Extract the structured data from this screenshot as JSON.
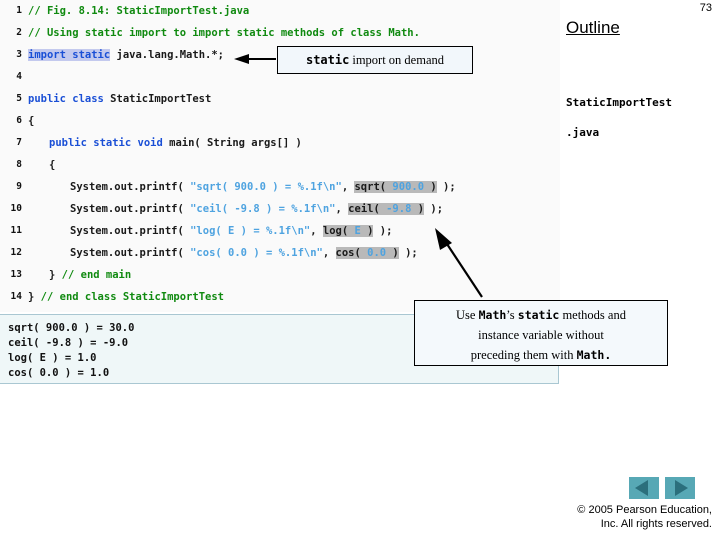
{
  "page": {
    "number": "73",
    "background_color": "#ffffff"
  },
  "outline": {
    "title": "Outline",
    "file_lines": [
      "StaticImportTest",
      ".java"
    ]
  },
  "code_panel": {
    "background_color": "#fafafa",
    "comment_color": "#108a10",
    "keyword_color": "#1a4fd6",
    "string_color": "#4ea3e0",
    "highlight_import_color": "#c3c9ee",
    "highlight_call_color": "#b9b9b9",
    "lines": [
      {
        "num": "1",
        "indent": 0,
        "tokens": [
          {
            "t": "// Fig. 8.14: StaticImportTest.java",
            "c": "cm"
          }
        ]
      },
      {
        "num": "2",
        "indent": 0,
        "tokens": [
          {
            "t": "// Using static import to import static methods of class Math.",
            "c": "cm"
          }
        ]
      },
      {
        "num": "3",
        "indent": 0,
        "tokens": [
          {
            "t": "import static",
            "c": "kw",
            "hl": "import"
          },
          {
            "t": " java.lang.Math.*;",
            "c": "pln"
          }
        ]
      },
      {
        "num": "4",
        "indent": 0,
        "tokens": []
      },
      {
        "num": "5",
        "indent": 0,
        "tokens": [
          {
            "t": "public class",
            "c": "kw"
          },
          {
            "t": " StaticImportTest",
            "c": "pln"
          }
        ]
      },
      {
        "num": "6",
        "indent": 0,
        "tokens": [
          {
            "t": "{",
            "c": "pln"
          }
        ]
      },
      {
        "num": "7",
        "indent": 3,
        "tokens": [
          {
            "t": "public static void",
            "c": "kw"
          },
          {
            "t": " main( String args[] )",
            "c": "pln"
          }
        ]
      },
      {
        "num": "8",
        "indent": 3,
        "tokens": [
          {
            "t": "{",
            "c": "pln"
          }
        ]
      },
      {
        "num": "9",
        "indent": 6,
        "tokens": [
          {
            "t": "System.out.printf( ",
            "c": "pln"
          },
          {
            "t": "\"sqrt( 900.0 ) = %.1f\\n\"",
            "c": "str"
          },
          {
            "t": ", ",
            "c": "pln"
          },
          {
            "t": "sqrt( ",
            "c": "pln",
            "hl": "call"
          },
          {
            "t": "900.0",
            "c": "num",
            "hl": "call"
          },
          {
            "t": " )",
            "c": "pln",
            "hl": "call"
          },
          {
            "t": " );",
            "c": "pln"
          }
        ]
      },
      {
        "num": "10",
        "indent": 6,
        "tokens": [
          {
            "t": "System.out.printf( ",
            "c": "pln"
          },
          {
            "t": "\"ceil( -9.8 ) = %.1f\\n\"",
            "c": "str"
          },
          {
            "t": ", ",
            "c": "pln"
          },
          {
            "t": "ceil( ",
            "c": "pln",
            "hl": "call"
          },
          {
            "t": "-9.8",
            "c": "num",
            "hl": "call"
          },
          {
            "t": " )",
            "c": "pln",
            "hl": "call"
          },
          {
            "t": " );",
            "c": "pln"
          }
        ]
      },
      {
        "num": "11",
        "indent": 6,
        "tokens": [
          {
            "t": "System.out.printf( ",
            "c": "pln"
          },
          {
            "t": "\"log( E ) = %.1f\\n\"",
            "c": "str"
          },
          {
            "t": ", ",
            "c": "pln"
          },
          {
            "t": "log( ",
            "c": "pln",
            "hl": "call"
          },
          {
            "t": "E",
            "c": "num",
            "hl": "call"
          },
          {
            "t": " )",
            "c": "pln",
            "hl": "call"
          },
          {
            "t": " );",
            "c": "pln"
          }
        ]
      },
      {
        "num": "12",
        "indent": 6,
        "tokens": [
          {
            "t": "System.out.printf( ",
            "c": "pln"
          },
          {
            "t": "\"cos( 0.0 ) = %.1f\\n\"",
            "c": "str"
          },
          {
            "t": ", ",
            "c": "pln"
          },
          {
            "t": "cos( ",
            "c": "pln",
            "hl": "call"
          },
          {
            "t": "0.0",
            "c": "num",
            "hl": "call"
          },
          {
            "t": " )",
            "c": "pln",
            "hl": "call"
          },
          {
            "t": " );",
            "c": "pln"
          }
        ]
      },
      {
        "num": "13",
        "indent": 3,
        "tokens": [
          {
            "t": "} ",
            "c": "pln"
          },
          {
            "t": "// end main",
            "c": "cm"
          }
        ]
      },
      {
        "num": "14",
        "indent": 0,
        "tokens": [
          {
            "t": "} ",
            "c": "pln"
          },
          {
            "t": "// end class StaticImportTest",
            "c": "cm"
          }
        ]
      }
    ]
  },
  "output_panel": {
    "background_color": "#eff7f8",
    "border_color": "#a9c7d2",
    "lines": [
      "sqrt( 900.0 ) = 30.0",
      "ceil( -9.8 ) = -9.0",
      "log( E ) = 1.0",
      "cos( 0.0 ) = 1.0"
    ]
  },
  "callouts": {
    "import_on_demand": {
      "mono_text": "static",
      "serif_text": "import on demand"
    },
    "math_static": {
      "lines": [
        [
          {
            "t": "Use ",
            "m": false
          },
          {
            "t": "Math",
            "m": true
          },
          {
            "t": "’s ",
            "m": false
          },
          {
            "t": "static",
            "m": true
          },
          {
            "t": " methods and",
            "m": false
          }
        ],
        [
          {
            "t": "instance variable without",
            "m": false
          }
        ],
        [
          {
            "t": "preceding them with ",
            "m": false
          },
          {
            "t": "Math.",
            "m": true
          }
        ]
      ]
    }
  },
  "nav": {
    "prev_label": "previous-slide",
    "next_label": "next-slide",
    "button_color": "#57a8b5",
    "arrow_color": "#2b6f7c"
  },
  "copyright": {
    "line1": "© 2005 Pearson Education,",
    "line2": "Inc.  All rights reserved."
  }
}
